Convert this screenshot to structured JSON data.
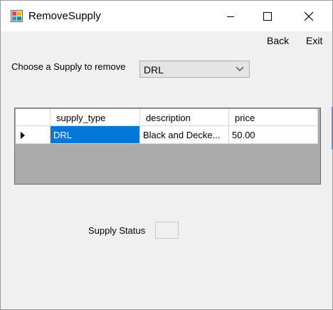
{
  "window": {
    "title": "RemoveSupply",
    "icon": "app-form-icon",
    "controls": [
      "minimize-icon",
      "maximize-icon",
      "close-icon"
    ]
  },
  "menu": {
    "back": "Back",
    "exit": "Exit"
  },
  "chooser": {
    "label": "Choose a Supply  to remove",
    "selected": "DRL"
  },
  "grid": {
    "columns": [
      "supply_type",
      "description",
      "price"
    ],
    "rows": [
      {
        "supply_type": "DRL",
        "description": "Black and Decke...",
        "price": "50.00"
      }
    ],
    "selected_cell": "supply_type"
  },
  "status": {
    "label": "Supply Status",
    "value": ""
  },
  "colors": {
    "selection": "#0078d7",
    "grid_background": "#ababab",
    "window_background": "#f0f0f0"
  }
}
